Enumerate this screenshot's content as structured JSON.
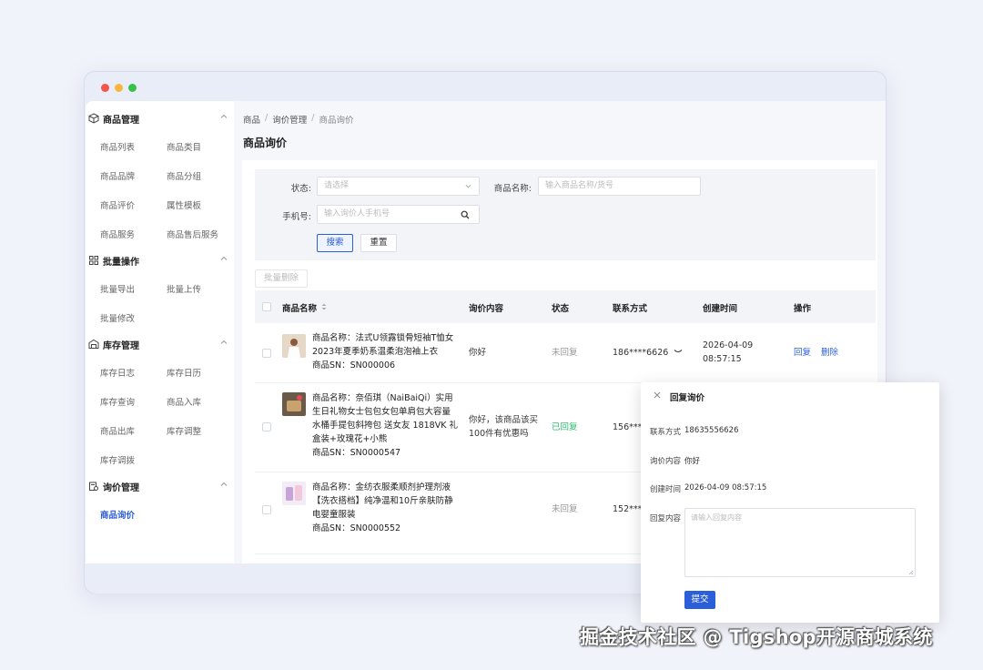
{
  "sidebar": {
    "groups": [
      {
        "title": "商品管理",
        "icon": "box-icon",
        "items": [
          "商品列表",
          "商品类目",
          "商品品牌",
          "商品分组",
          "商品评价",
          "属性模板",
          "商品服务",
          "商品售后服务"
        ]
      },
      {
        "title": "批量操作",
        "icon": "grid-icon",
        "items": [
          "批量导出",
          "批量上传",
          "批量修改"
        ]
      },
      {
        "title": "库存管理",
        "icon": "warehouse-icon",
        "items": [
          "库存日志",
          "库存日历",
          "库存查询",
          "商品入库",
          "商品出库",
          "库存调整",
          "库存调拨"
        ]
      },
      {
        "title": "询价管理",
        "icon": "inquiry-icon",
        "items": [
          "商品询价"
        ]
      }
    ],
    "active_item": "商品询价"
  },
  "breadcrumb": [
    "商品",
    "询价管理",
    "商品询价"
  ],
  "page_title": "商品询价",
  "filters": {
    "status_label": "状态:",
    "status_placeholder": "请选择",
    "name_label": "商品名称:",
    "name_placeholder": "输入商品名称/货号",
    "phone_label": "手机号:",
    "phone_placeholder": "输入询价人手机号",
    "search_button": "搜索",
    "reset_button": "重置"
  },
  "batch_delete": "批量删除",
  "table": {
    "columns": [
      "商品名称",
      "询价内容",
      "状态",
      "联系方式",
      "创建时间",
      "操作"
    ],
    "rows": [
      {
        "name": [
          "商品名称：法式U领露锁骨短袖T恤女",
          "2023年夏季奶系温柔泡泡袖上衣",
          "商品SN：SN000006"
        ],
        "content": [
          "你好"
        ],
        "status": "未回复",
        "contact": "186****6626",
        "time": [
          "2026-04-09",
          "08:57:15"
        ],
        "actions": [
          "回复",
          "删除"
        ]
      },
      {
        "name": [
          "商品名称：奈佰琪（NaiBaiQi）实用",
          "生日礼物女士包包女包单肩包大容量",
          "水桶手提包斜挎包 送女友 1818VK 礼",
          "盒装+玫瑰花+小熊",
          "商品SN：SN0000547"
        ],
        "content": [
          "你好，该商品该买",
          "100件有优惠吗"
        ],
        "status": "已回复",
        "contact": "156****",
        "time": [],
        "actions": []
      },
      {
        "name": [
          "商品名称：金纺衣服柔顺剂护理剂液",
          "【洗衣搭档】纯净温和10斤亲肤防静",
          "电婴童服装",
          "商品SN：SN0000552"
        ],
        "content": [],
        "status": "未回复",
        "contact": "152****",
        "time": [],
        "actions": []
      }
    ]
  },
  "dialog": {
    "title": "回复询价",
    "contact_label": "联系方式",
    "contact_value": "18635556626",
    "content_label": "询价内容",
    "content_value": "你好",
    "time_label": "创建时间",
    "time_value": "2026-04-09 08:57:15",
    "reply_label": "回复内容",
    "reply_placeholder": "请输入回复内容",
    "submit_button": "提交"
  },
  "watermark": "掘金技术社区 @ Tigshop开源商城系统",
  "colors": {
    "primary": "#2b5fd9",
    "replied": "#2fbf71",
    "unreplied": "#999999"
  }
}
